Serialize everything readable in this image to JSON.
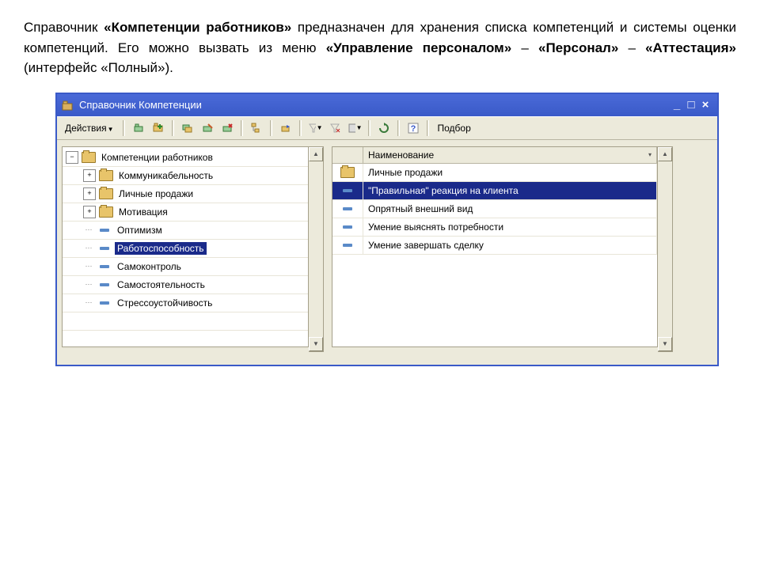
{
  "description_parts": {
    "p1": "Справочник ",
    "b1": "«Компетенции работников»",
    "p2": "  предназначен для хранения списка компетенций и системы оценки компетенций. Его можно вызвать из меню ",
    "b2": "«Управление персоналом»",
    "p3": "  –  ",
    "b3": "«Персонал»",
    "p4": "  –  ",
    "b4": "«Аттестация»",
    "p5": "  (интерфейс «Полный»)."
  },
  "window": {
    "title": "Справочник Компетенции"
  },
  "toolbar": {
    "actions": "Действия",
    "selection": "Подбор"
  },
  "tree": {
    "root": "Компетенции работников",
    "items": [
      {
        "label": "Коммуникабельность",
        "type": "folder",
        "expand": "+"
      },
      {
        "label": "Личные продажи",
        "type": "folder",
        "expand": "+"
      },
      {
        "label": "Мотивация",
        "type": "folder",
        "expand": "+"
      },
      {
        "label": "Оптимизм",
        "type": "item",
        "expand": ""
      },
      {
        "label": "Работоспособность",
        "type": "item",
        "expand": "",
        "selected": true
      },
      {
        "label": "Самоконтроль",
        "type": "item",
        "expand": ""
      },
      {
        "label": "Самостоятельность",
        "type": "item",
        "expand": ""
      },
      {
        "label": "Стрессоустойчивость",
        "type": "item",
        "expand": ""
      }
    ]
  },
  "grid": {
    "header": "Наименование",
    "rows": [
      {
        "label": "Личные продажи",
        "type": "folder"
      },
      {
        "label": "\"Правильная\" реакция на клиента",
        "type": "item",
        "selected": true
      },
      {
        "label": "Опрятный внешний вид",
        "type": "item"
      },
      {
        "label": "Умение выяснять потребности",
        "type": "item"
      },
      {
        "label": "Умение завершать сделку",
        "type": "item"
      }
    ]
  }
}
